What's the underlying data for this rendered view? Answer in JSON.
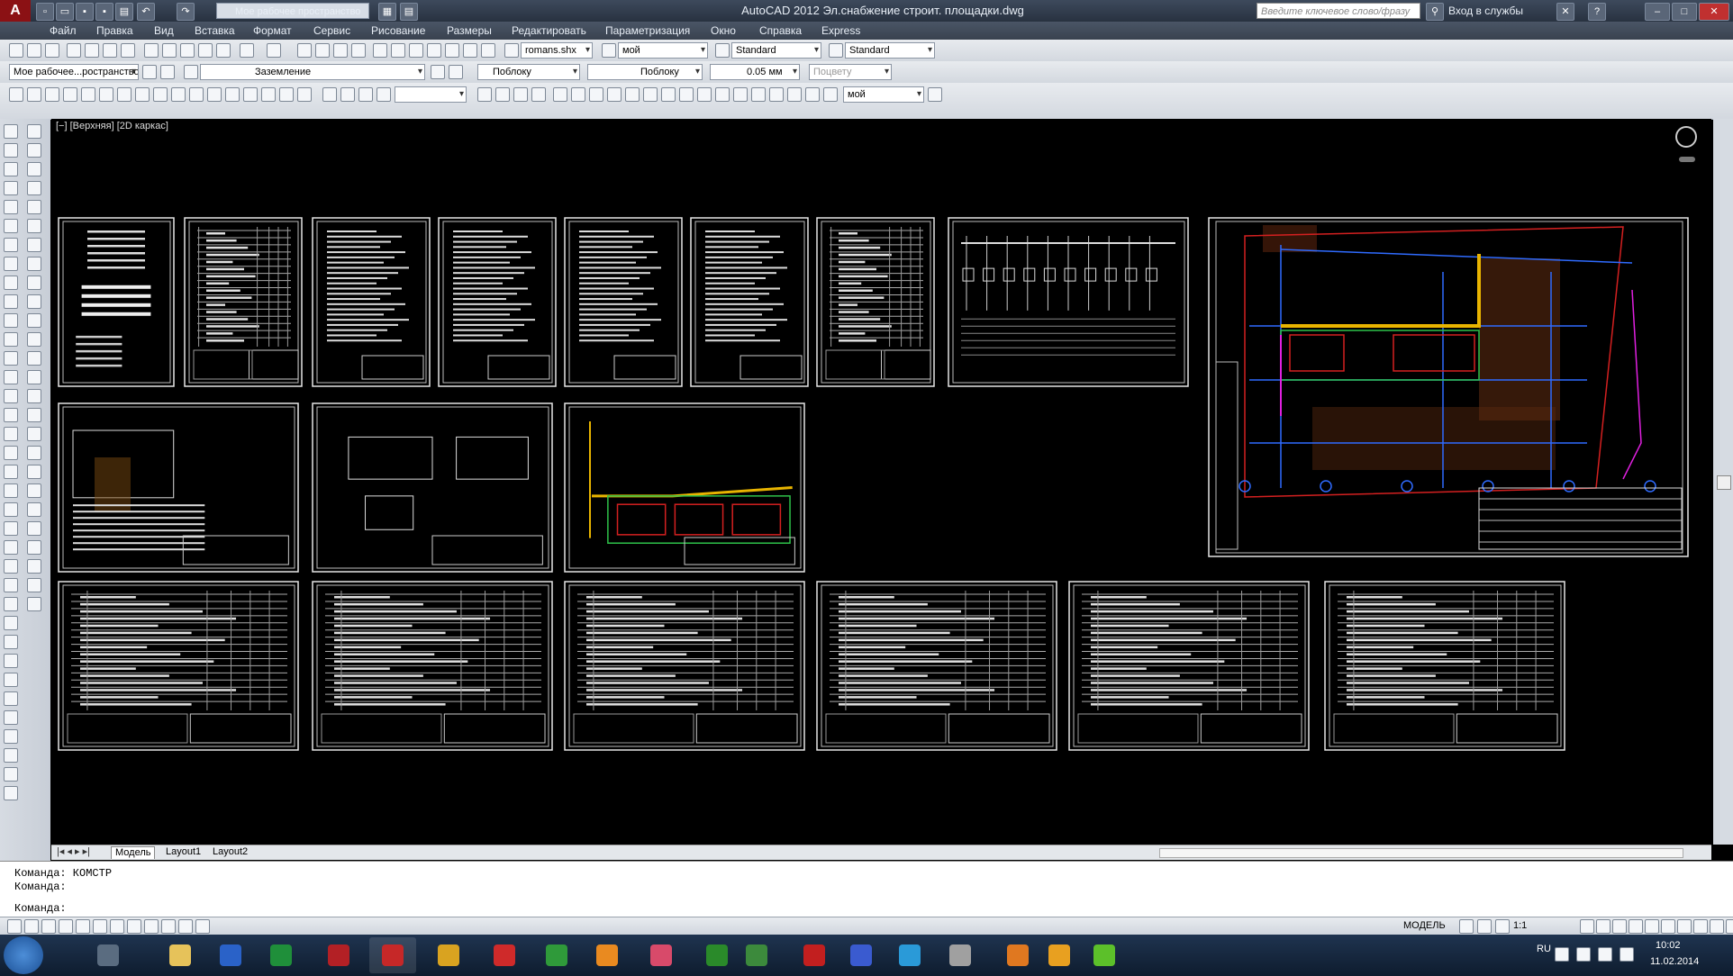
{
  "app": {
    "logo": "A",
    "workspace": "Мое рабочее пространство",
    "title": "AutoCAD 2012   Эл.снабжение строит. площадки.dwg",
    "search_placeholder": "Введите ключевое слово/фразу",
    "login": "Вход в службы"
  },
  "menu": [
    "Файл",
    "Правка",
    "Вид",
    "Вставка",
    "Формат",
    "Сервис",
    "Рисование",
    "Размеры",
    "Редактировать",
    "Параметризация",
    "Окно",
    "Справка",
    "Express"
  ],
  "toolbar_row2": {
    "textstyle": "romans.shx",
    "dimstyle": "мой",
    "tablestyle": "Standard",
    "mleaderstyle": "Standard"
  },
  "toolbar_row3": {
    "workspace": "Мое рабочее...ространство",
    "layer": "Заземление",
    "color": "Поблоку",
    "linetype": "Поблоку",
    "lineweight": "0.05 мм",
    "plotstyle": "Поцвету"
  },
  "toolbar_row4": {
    "dimstyle2": "мой"
  },
  "viewport_label": "[−] [Верхняя] [2D каркас]",
  "tabs": [
    "Модель",
    "Layout1",
    "Layout2"
  ],
  "command_lines": [
    "Команда: КОМСТР",
    "Команда:",
    "Команда:"
  ],
  "status": {
    "model": "МОДЕЛЬ",
    "scale": "1:1"
  },
  "taskbar": {
    "lang": "RU",
    "time": "10:02",
    "date": "11.02.2014"
  },
  "colors": {
    "background": "#000000",
    "sheet_border": "#e6e6e6",
    "accent_red": "#d42020",
    "accent_yellow": "#e8b400",
    "accent_blue": "#2f6bff",
    "accent_green": "#2ec24a",
    "accent_magenta": "#e020e0"
  },
  "icons": [
    "autocad-logo-icon",
    "new-icon",
    "open-icon",
    "save-icon",
    "print-icon",
    "undo-icon",
    "redo-icon",
    "binoculars-icon",
    "exchange-icon",
    "help-icon",
    "minimize-icon",
    "maximize-icon",
    "close-icon",
    "viewcube-icon",
    "start-icon"
  ]
}
